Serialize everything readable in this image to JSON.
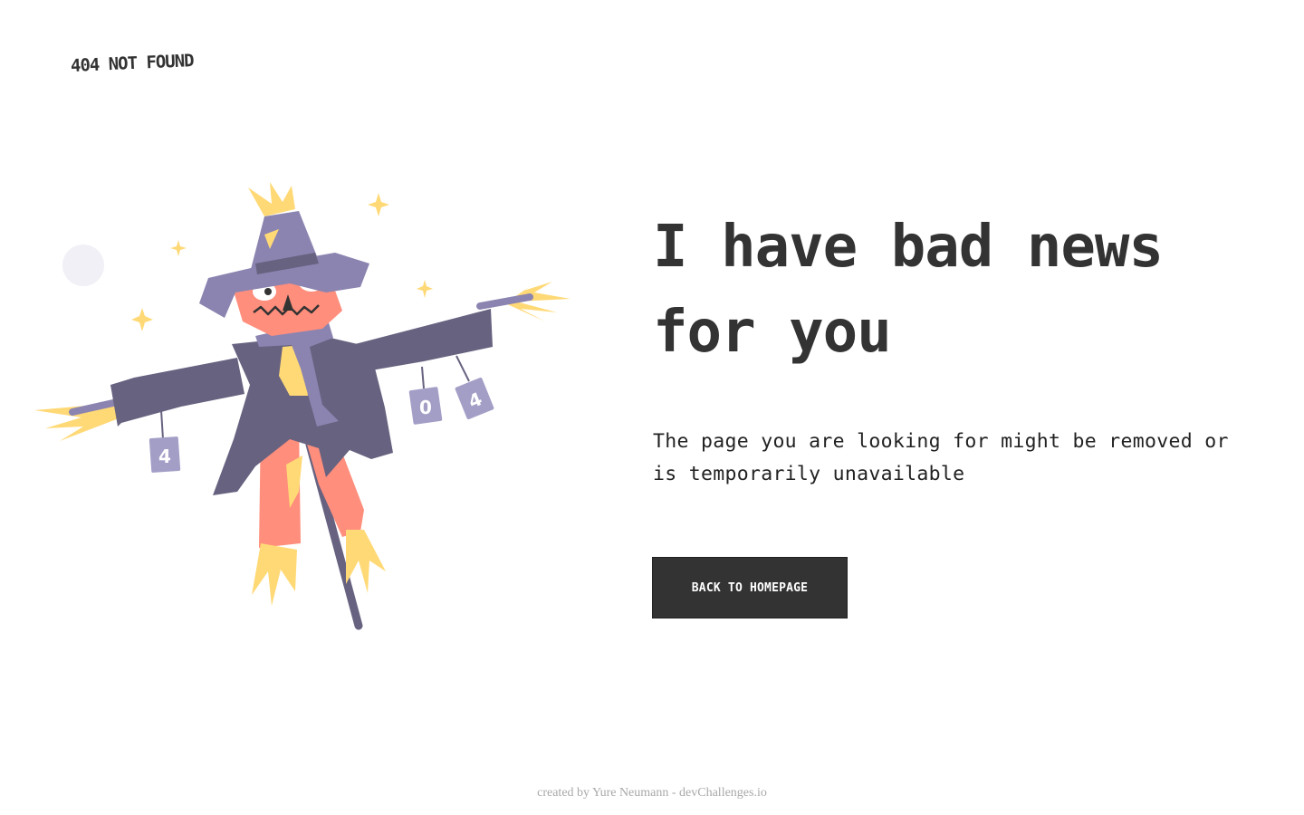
{
  "brand": {
    "label": "404 NOT FOUND"
  },
  "hero": {
    "headline_line1": "I have bad news",
    "headline_line2": "for you",
    "message": "The page you are looking for might be removed or is temporarily unavailable",
    "cta_label": "BACK TO HOMEPAGE"
  },
  "illustration": {
    "subject": "scarecrow-icon",
    "cans": [
      "4",
      "0",
      "4"
    ]
  },
  "footer": {
    "credit": "created by Yure Neumann - devChallenges.io"
  },
  "colors": {
    "text": "#333333",
    "button_bg": "#333333",
    "button_text": "#ffffff",
    "credit_text": "#a9a9a9",
    "coat": "#676280",
    "hat": "#8b84b0",
    "face": "#ff8e7c",
    "straw": "#ffd976",
    "moon": "#f0f0f6"
  }
}
